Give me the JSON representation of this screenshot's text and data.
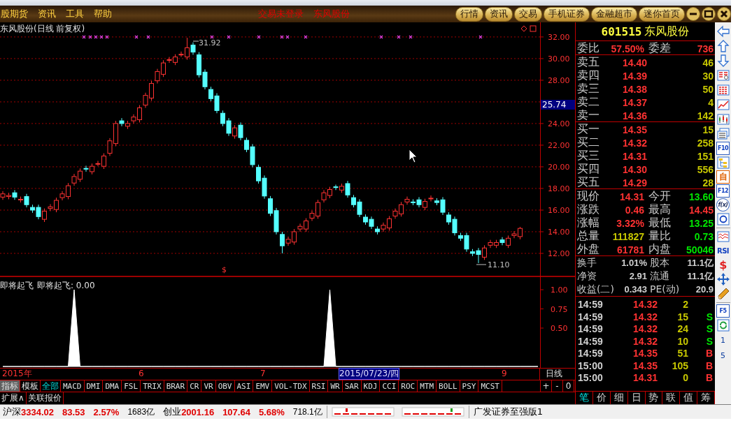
{
  "title_bar": {
    "menu": [
      "股期货",
      "资讯",
      "工具",
      "帮助"
    ],
    "status": [
      "交易未登录",
      "东风股份"
    ],
    "buttons": [
      "行情",
      "资讯",
      "交易",
      "手机证券",
      "金融超市",
      "迷你首页"
    ]
  },
  "chart": {
    "title": "东风股份(日线 前复权)",
    "high_label": "31.92",
    "low_label": "11.10",
    "signal_mark": "$",
    "crosshair_price": "25.74",
    "chart_data": {
      "type": "candlestick",
      "ylim": [
        9.87,
        33.35
      ],
      "yticks": [
        {
          "value": 32,
          "label": "32.00"
        },
        {
          "value": 30,
          "label": "30.00"
        },
        {
          "value": 28,
          "label": "28.00"
        },
        {
          "value": 24,
          "label": "24.00"
        },
        {
          "value": 22,
          "label": "22.00"
        },
        {
          "value": 20,
          "label": "20.00"
        },
        {
          "value": 18,
          "label": "18.00"
        },
        {
          "value": 16,
          "label": "16.00"
        },
        {
          "value": 14,
          "label": "14.00"
        },
        {
          "value": 12,
          "label": "12.00"
        }
      ],
      "ohlc": [
        [
          17.2,
          17.75,
          16.95,
          17.5
        ],
        [
          17.25,
          17.6,
          17.0,
          17.35
        ],
        [
          17.6,
          17.85,
          16.95,
          17.2
        ],
        [
          16.95,
          17.25,
          16.7,
          17.0
        ],
        [
          17.25,
          17.5,
          16.25,
          16.5
        ],
        [
          16.25,
          16.5,
          15.75,
          16.0
        ],
        [
          16.25,
          16.5,
          15.15,
          15.4
        ],
        [
          15.15,
          16.15,
          14.9,
          15.9
        ],
        [
          16.15,
          16.55,
          15.9,
          16.3
        ],
        [
          16.05,
          17.15,
          15.8,
          16.9
        ],
        [
          17.15,
          17.75,
          16.9,
          17.5
        ],
        [
          17.25,
          18.5,
          17.0,
          18.25
        ],
        [
          18.5,
          19.35,
          18.25,
          19.1
        ],
        [
          18.85,
          19.85,
          18.6,
          19.6
        ],
        [
          19.85,
          20.1,
          19.55,
          19.8
        ],
        [
          19.55,
          20.3,
          19.3,
          20.05
        ],
        [
          20.3,
          20.55,
          20.05,
          20.3
        ],
        [
          20.05,
          21.25,
          19.8,
          21.0
        ],
        [
          21.25,
          22.65,
          21.0,
          22.4
        ],
        [
          22.15,
          24.25,
          21.9,
          24.0
        ],
        [
          24.25,
          24.5,
          23.75,
          24.0
        ],
        [
          23.75,
          24.25,
          23.5,
          24.0
        ],
        [
          24.25,
          24.85,
          24.0,
          24.6
        ],
        [
          24.35,
          25.7,
          24.1,
          25.45
        ],
        [
          25.7,
          26.85,
          25.45,
          26.6
        ],
        [
          26.35,
          27.95,
          26.1,
          27.7
        ],
        [
          27.95,
          29.05,
          27.7,
          28.8
        ],
        [
          28.55,
          29.85,
          28.3,
          29.6
        ],
        [
          29.85,
          30.15,
          29.6,
          29.9
        ],
        [
          29.65,
          30.4,
          29.4,
          30.15
        ],
        [
          30.4,
          30.65,
          30.15,
          30.4
        ],
        [
          30.15,
          31.92,
          29.9,
          31.0
        ],
        [
          31.25,
          31.5,
          30.35,
          30.6
        ],
        [
          30.35,
          30.6,
          28.25,
          28.5
        ],
        [
          28.75,
          29.0,
          27.15,
          27.4
        ],
        [
          27.15,
          27.4,
          26.05,
          26.3
        ],
        [
          26.55,
          26.8,
          24.95,
          25.2
        ],
        [
          24.95,
          25.2,
          23.75,
          24.0
        ],
        [
          24.25,
          24.5,
          22.85,
          23.1
        ],
        [
          22.85,
          23.85,
          22.6,
          23.6
        ],
        [
          23.85,
          24.1,
          22.45,
          22.7
        ],
        [
          22.45,
          22.7,
          21.35,
          21.6
        ],
        [
          21.85,
          22.1,
          19.95,
          20.2
        ],
        [
          19.95,
          20.2,
          18.45,
          18.7
        ],
        [
          18.95,
          19.2,
          17.05,
          17.3
        ],
        [
          17.05,
          17.3,
          15.45,
          15.7
        ],
        [
          15.95,
          16.2,
          13.75,
          14.0
        ],
        [
          13.75,
          14.0,
          12.0,
          12.7
        ],
        [
          12.95,
          13.55,
          12.7,
          13.3
        ],
        [
          13.05,
          14.25,
          12.8,
          14.0
        ],
        [
          14.25,
          14.75,
          14.0,
          14.5
        ],
        [
          14.25,
          15.25,
          14.0,
          15.0
        ],
        [
          15.25,
          15.95,
          15.0,
          15.7
        ],
        [
          15.45,
          16.95,
          15.2,
          16.7
        ],
        [
          16.95,
          17.85,
          16.7,
          17.6
        ],
        [
          17.35,
          18.15,
          17.1,
          17.9
        ],
        [
          18.15,
          18.35,
          17.85,
          18.1
        ],
        [
          17.85,
          18.45,
          17.6,
          18.2
        ],
        [
          18.45,
          18.7,
          17.15,
          17.4
        ],
        [
          17.15,
          17.4,
          16.25,
          16.5
        ],
        [
          16.75,
          17.0,
          15.35,
          15.6
        ],
        [
          15.35,
          15.6,
          14.65,
          14.9
        ],
        [
          15.15,
          15.4,
          14.25,
          14.5
        ],
        [
          14.25,
          14.5,
          13.75,
          14.0
        ],
        [
          14.25,
          14.85,
          14.0,
          14.6
        ],
        [
          14.35,
          15.45,
          14.1,
          15.2
        ],
        [
          15.45,
          16.15,
          15.2,
          15.9
        ],
        [
          15.65,
          16.75,
          15.4,
          16.5
        ],
        [
          16.75,
          17.25,
          16.5,
          17.0
        ],
        [
          16.75,
          17.0,
          16.45,
          16.7
        ],
        [
          16.95,
          17.2,
          16.25,
          16.5
        ],
        [
          16.25,
          17.05,
          16.0,
          16.8
        ],
        [
          17.05,
          17.35,
          16.8,
          17.1
        ],
        [
          16.85,
          17.1,
          16.45,
          16.7
        ],
        [
          16.95,
          17.2,
          15.55,
          15.8
        ],
        [
          15.55,
          15.8,
          14.65,
          14.9
        ],
        [
          15.15,
          15.4,
          13.65,
          13.9
        ],
        [
          13.65,
          13.9,
          13.15,
          13.4
        ],
        [
          13.65,
          13.9,
          12.15,
          12.4
        ],
        [
          12.15,
          12.4,
          11.75,
          12.0
        ],
        [
          12.25,
          12.5,
          11.1,
          11.9
        ],
        [
          11.65,
          12.75,
          11.4,
          12.5
        ],
        [
          12.75,
          13.25,
          12.5,
          13.0
        ],
        [
          12.75,
          13.25,
          12.5,
          13.0
        ],
        [
          13.25,
          13.5,
          12.75,
          13.0
        ],
        [
          12.75,
          13.65,
          12.5,
          13.4
        ],
        [
          13.65,
          14.05,
          13.4,
          13.8
        ],
        [
          13.55,
          14.45,
          13.3,
          14.31
        ]
      ]
    }
  },
  "indicator": {
    "value_label": "即将起飞: 0.00",
    "chart_data": {
      "type": "area",
      "ylim": [
        0,
        1
      ],
      "yticks": [
        {
          "value": 1,
          "label": "1.00"
        },
        {
          "value": 0.75,
          "label": "0.75"
        },
        {
          "value": 0.5,
          "label": "0.50"
        }
      ],
      "series": [
        {
          "name": "即将起飞",
          "color": "#ffffff",
          "values": [
            0,
            0,
            0,
            0,
            0,
            0,
            0,
            0,
            0,
            0,
            0,
            0,
            1,
            0,
            0,
            0,
            0,
            0,
            0,
            0,
            0,
            0,
            0,
            0,
            0,
            0,
            0,
            0,
            0,
            0,
            0,
            0,
            0,
            0,
            0,
            0,
            0,
            0,
            0,
            0,
            0,
            0,
            0,
            0,
            0,
            0,
            0,
            0,
            0,
            0,
            0,
            0,
            0,
            0,
            0,
            1,
            0,
            0,
            0,
            0,
            0,
            0,
            0,
            0,
            0,
            0,
            0,
            0,
            0,
            0,
            0,
            0,
            0,
            0,
            0,
            0,
            0,
            0,
            0,
            0,
            0,
            0,
            0,
            0,
            0,
            0,
            0,
            0,
            0,
            0,
            0
          ]
        }
      ]
    }
  },
  "time_axis": {
    "labels": [
      {
        "text": "2015年",
        "selected": false
      },
      {
        "text": "6",
        "selected": false
      },
      {
        "text": "7",
        "selected": false
      },
      {
        "text": "2015/07/23/四",
        "selected": true
      },
      {
        "text": "9",
        "selected": false
      }
    ],
    "period": "日线"
  },
  "indicator_tabs": [
    {
      "label": "指标",
      "highlighted": true,
      "selected": false
    },
    {
      "label": "模板",
      "highlighted": false,
      "selected": false
    },
    {
      "label": "全部",
      "highlighted": false,
      "selected": true
    },
    {
      "label": "MACD",
      "highlighted": false,
      "selected": false
    },
    {
      "label": "DMI",
      "highlighted": false,
      "selected": false
    },
    {
      "label": "DMA",
      "highlighted": false,
      "selected": false
    },
    {
      "label": "FSL",
      "highlighted": false,
      "selected": false
    },
    {
      "label": "TRIX",
      "highlighted": false,
      "selected": false
    },
    {
      "label": "BRAR",
      "highlighted": false,
      "selected": false
    },
    {
      "label": "CR",
      "highlighted": false,
      "selected": false
    },
    {
      "label": "VR",
      "highlighted": false,
      "selected": false
    },
    {
      "label": "OBV",
      "highlighted": false,
      "selected": false
    },
    {
      "label": "ASI",
      "highlighted": false,
      "selected": false
    },
    {
      "label": "EMV",
      "highlighted": false,
      "selected": false
    },
    {
      "label": "VOL-TDX",
      "highlighted": false,
      "selected": false
    },
    {
      "label": "RSI",
      "highlighted": false,
      "selected": false
    },
    {
      "label": "WR",
      "highlighted": false,
      "selected": false
    },
    {
      "label": "SAR",
      "highlighted": false,
      "selected": false
    },
    {
      "label": "KDJ",
      "highlighted": false,
      "selected": false
    },
    {
      "label": "CCI",
      "highlighted": false,
      "selected": false
    },
    {
      "label": "ROC",
      "highlighted": false,
      "selected": false
    },
    {
      "label": "MTM",
      "highlighted": false,
      "selected": false
    },
    {
      "label": "BOLL",
      "highlighted": false,
      "selected": false
    },
    {
      "label": "PSY",
      "highlighted": false,
      "selected": false
    },
    {
      "label": "MCST",
      "highlighted": false,
      "selected": false
    }
  ],
  "zoom_buttons": [
    "+",
    "-",
    "0"
  ],
  "extra_tabs": [
    "扩展∧",
    "关联报价"
  ],
  "quote": {
    "code": "601515",
    "name": "东风股份",
    "ratio": {
      "label": "委比",
      "value": "57.50%",
      "label2": "委差",
      "value2": "736"
    },
    "asks": [
      {
        "label": "卖五",
        "price": "14.40",
        "volume": "46"
      },
      {
        "label": "卖四",
        "price": "14.39",
        "volume": "30"
      },
      {
        "label": "卖三",
        "price": "14.38",
        "volume": "50"
      },
      {
        "label": "卖二",
        "price": "14.37",
        "volume": "4"
      },
      {
        "label": "卖一",
        "price": "14.36",
        "volume": "142"
      }
    ],
    "bids": [
      {
        "label": "买一",
        "price": "14.35",
        "volume": "15"
      },
      {
        "label": "买二",
        "price": "14.32",
        "volume": "258"
      },
      {
        "label": "买三",
        "price": "14.31",
        "volume": "151"
      },
      {
        "label": "买四",
        "price": "14.30",
        "volume": "556"
      },
      {
        "label": "买五",
        "price": "14.29",
        "volume": "28"
      }
    ],
    "stats": [
      {
        "cells": [
          {
            "label": "现价",
            "value": "14.31",
            "color": "#ff3232"
          },
          {
            "label": "今开",
            "value": "13.60",
            "color": "#00e600"
          }
        ]
      },
      {
        "cells": [
          {
            "label": "涨跌",
            "value": "0.46",
            "color": "#ff3232"
          },
          {
            "label": "最高",
            "value": "14.45",
            "color": "#ff3232"
          }
        ]
      },
      {
        "cells": [
          {
            "label": "涨幅",
            "value": "3.32%",
            "color": "#ff3232"
          },
          {
            "label": "最低",
            "value": "13.25",
            "color": "#00e600"
          }
        ]
      },
      {
        "cells": [
          {
            "label": "总量",
            "value": "111827",
            "color": "#c8c800"
          },
          {
            "label": "量比",
            "value": "0.73",
            "color": "#00e600"
          }
        ]
      },
      {
        "cells": [
          {
            "label": "外盘",
            "value": "61781",
            "color": "#ff3232"
          },
          {
            "label": "内盘",
            "value": "50046",
            "color": "#00e600"
          }
        ]
      }
    ],
    "info": [
      {
        "cells": [
          {
            "label": "换手",
            "value": "1.01%"
          },
          {
            "label": "股本",
            "value": "11.1亿"
          }
        ]
      },
      {
        "cells": [
          {
            "label": "净资",
            "value": "2.91"
          },
          {
            "label": "流通",
            "value": "11.1亿"
          }
        ]
      },
      {
        "cells": [
          {
            "label": "收益(二)",
            "value": "0.343"
          },
          {
            "label": "PE(动)",
            "value": "20.9"
          }
        ]
      }
    ],
    "ticks": [
      {
        "time": "14:59",
        "price": "14.32",
        "volume": "2"
      },
      {
        "time": "14:59",
        "price": "14.32",
        "volume": "15",
        "side": "S",
        "color": "#00e600"
      },
      {
        "time": "14:59",
        "price": "14.32",
        "volume": "24",
        "side": "S",
        "color": "#00e600"
      },
      {
        "time": "14:59",
        "price": "14.32",
        "volume": "10",
        "side": "S",
        "color": "#00e600"
      },
      {
        "time": "14:59",
        "price": "14.35",
        "volume": "51",
        "side": "B",
        "color": "#ff3232"
      },
      {
        "time": "15:00",
        "price": "14.35",
        "volume": "105",
        "side": "B",
        "color": "#ff3232"
      },
      {
        "time": "15:00",
        "price": "14.31",
        "volume": "0",
        "side": "B",
        "color": "#ff3232"
      }
    ],
    "tabs": [
      {
        "label": "笔",
        "selected": true
      },
      {
        "label": "价",
        "selected": false
      },
      {
        "label": "细",
        "selected": false
      },
      {
        "label": "日",
        "selected": false
      },
      {
        "label": "势",
        "selected": false
      },
      {
        "label": "联",
        "selected": false
      },
      {
        "label": "值",
        "selected": false
      },
      {
        "label": "筹",
        "selected": false
      }
    ]
  },
  "side_toolbar": {
    "texts": [
      "F10",
      "自",
      "F12",
      "f(x)",
      "RSI",
      "$",
      "F5"
    ],
    "pages": [
      "1",
      "5"
    ]
  },
  "status_bar": {
    "markets": [
      {
        "label": "沪深",
        "index": "3334.02",
        "change": "83.53",
        "percent": "2.57%",
        "amount": "1683亿"
      },
      {
        "label": "创业",
        "index": "2001.16",
        "change": "107.64",
        "percent": "5.68%",
        "amount": "718.1亿"
      }
    ],
    "broker": "广发证券至强版1"
  }
}
